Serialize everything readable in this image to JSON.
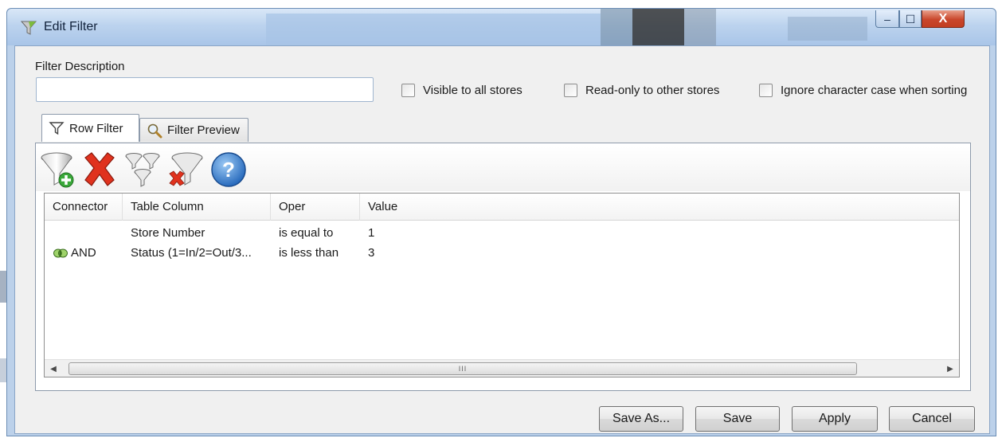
{
  "window": {
    "title": "Edit Filter",
    "controls": {
      "minimize": "–",
      "maximize": "☐",
      "close": "X"
    }
  },
  "form": {
    "description_label": "Filter Description",
    "description_value": "",
    "checkboxes": [
      {
        "label": "Visible to all stores",
        "checked": false
      },
      {
        "label": "Read-only to other stores",
        "checked": false
      },
      {
        "label": "Ignore character case when sorting",
        "checked": false
      }
    ]
  },
  "tabs": [
    {
      "label": "Row Filter",
      "icon": "funnel-icon",
      "active": true
    },
    {
      "label": "Filter Preview",
      "icon": "magnifier-icon",
      "active": false
    }
  ],
  "toolbar": {
    "buttons": [
      {
        "icon": "add-filter-icon"
      },
      {
        "icon": "delete-icon"
      },
      {
        "icon": "group-filter-icon"
      },
      {
        "icon": "remove-filter-icon"
      },
      {
        "icon": "help-icon"
      }
    ]
  },
  "grid": {
    "columns": [
      "Connector",
      "Table Column",
      "Oper",
      "Value"
    ],
    "rows": [
      {
        "connector": "",
        "column": "Store Number",
        "oper": "is equal to",
        "value": "1"
      },
      {
        "connector": "AND",
        "column": "Status (1=In/2=Out/3...",
        "oper": "is less than",
        "value": "3"
      }
    ],
    "scrollbar_grip": "III"
  },
  "buttons": {
    "save_as": "Save As...",
    "save": "Save",
    "apply": "Apply",
    "cancel": "Cancel"
  },
  "colors": {
    "window_frame": "#bcd1ea",
    "close_button": "#c9462b",
    "delete_red": "#e0321e",
    "help_blue": "#2f7fd6",
    "add_green": "#3aa83a"
  }
}
